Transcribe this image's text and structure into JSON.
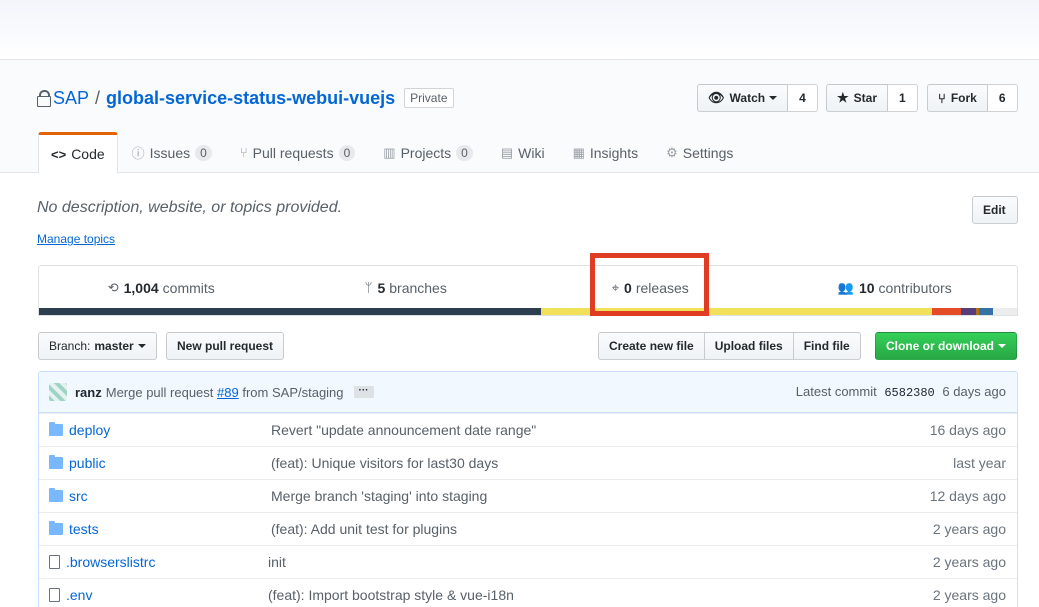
{
  "repo": {
    "owner": "SAP",
    "separator": "/",
    "name": "global-service-status-webui-vuejs",
    "visibility": "Private"
  },
  "actions": {
    "watch": {
      "label": "Watch",
      "count": "4"
    },
    "star": {
      "label": "Star",
      "count": "1"
    },
    "fork": {
      "label": "Fork",
      "count": "6"
    }
  },
  "tabs": [
    {
      "label": "Code",
      "icon": "code-icon",
      "selected": true
    },
    {
      "label": "Issues",
      "count": "0",
      "icon": "issue-icon"
    },
    {
      "label": "Pull requests",
      "count": "0",
      "icon": "pull-request-icon"
    },
    {
      "label": "Projects",
      "count": "0",
      "icon": "project-icon"
    },
    {
      "label": "Wiki",
      "icon": "book-icon"
    },
    {
      "label": "Insights",
      "icon": "graph-icon"
    },
    {
      "label": "Settings",
      "icon": "gear-icon"
    }
  ],
  "about": {
    "description": "No description, website, or topics provided.",
    "edit_label": "Edit",
    "manage_topics": "Manage topics"
  },
  "summary": {
    "commits": {
      "count": "1,004",
      "label": "commits"
    },
    "branches": {
      "count": "5",
      "label": "branches"
    },
    "releases": {
      "count": "0",
      "label": "releases"
    },
    "contributors": {
      "count": "10",
      "label": "contributors"
    }
  },
  "language_bar": [
    {
      "color": "#2c3e50",
      "fraction": 0.513
    },
    {
      "color": "#f1e05a",
      "fraction": 0.4
    },
    {
      "color": "#e34c26",
      "fraction": 0.03
    },
    {
      "color": "#563d7c",
      "fraction": 0.015
    },
    {
      "color": "#b07219",
      "fraction": 0.003
    },
    {
      "color": "#3572a5",
      "fraction": 0.015
    },
    {
      "color": "#ededed",
      "fraction": 0.024
    }
  ],
  "toolbar": {
    "branch_prefix": "Branch:",
    "branch": "master",
    "new_pull_request": "New pull request",
    "create_new_file": "Create new file",
    "upload_files": "Upload files",
    "find_file": "Find file",
    "clone_or_download": "Clone or download"
  },
  "latest_commit": {
    "author": "ranz",
    "message_prefix": "Merge pull request",
    "pr": "#89",
    "message_suffix": "from SAP/staging",
    "ellipsis": "···",
    "latest_label": "Latest commit",
    "sha": "6582380",
    "age": "6 days ago"
  },
  "files": [
    {
      "type": "dir",
      "name": "deploy",
      "message": "Revert \"update announcement date range\"",
      "age": "16 days ago"
    },
    {
      "type": "dir",
      "name": "public",
      "message": "(feat): Unique visitors for last30 days",
      "age": "last year"
    },
    {
      "type": "dir",
      "name": "src",
      "message": "Merge branch 'staging' into staging",
      "age": "12 days ago"
    },
    {
      "type": "dir",
      "name": "tests",
      "message": "(feat): Add unit test for plugins",
      "age": "2 years ago"
    },
    {
      "type": "file",
      "name": ".browserslistrc",
      "message": "init",
      "age": "2 years ago"
    },
    {
      "type": "file",
      "name": ".env",
      "message": "(feat): Import bootstrap style & vue-i18n",
      "age": "2 years ago"
    }
  ]
}
